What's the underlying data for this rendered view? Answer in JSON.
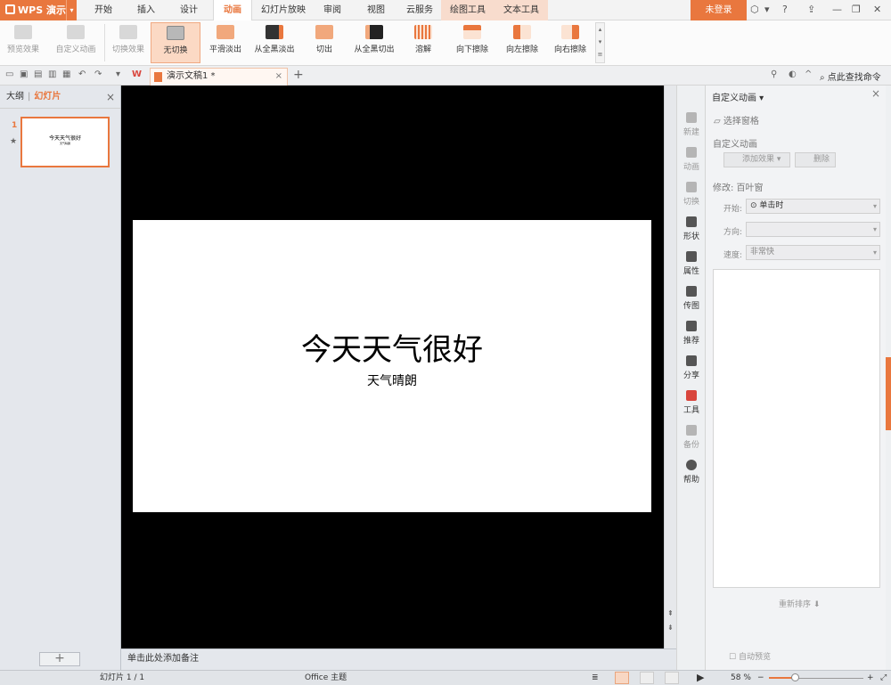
{
  "app": {
    "name": "WPS 演示"
  },
  "menu": {
    "tabs": [
      "开始",
      "插入",
      "设计",
      "动画",
      "幻灯片放映",
      "审阅",
      "视图",
      "云服务",
      "绘图工具",
      "文本工具"
    ],
    "active": "动画",
    "login": "未登录"
  },
  "ribbon": {
    "items": [
      "预览效果",
      "自定义动画",
      "切换效果",
      "无切换",
      "平滑淡出",
      "从全黑淡出",
      "切出",
      "从全黑切出",
      "溶解",
      "向下擦除",
      "向左擦除",
      "向右擦除"
    ]
  },
  "doc": {
    "tab_title": "演示文稿1 *",
    "find_command": "点此查找命令"
  },
  "left_pane": {
    "tab_outline": "大纲",
    "tab_slides": "幻灯片",
    "slide_number": "1"
  },
  "slide": {
    "title": "今天天气很好",
    "subtitle": "天气晴朗"
  },
  "notes": {
    "placeholder": "单击此处添加备注"
  },
  "side_strip": [
    "新建",
    "动画",
    "切换",
    "形状",
    "属性",
    "传图",
    "推荐",
    "分享",
    "工具",
    "备份",
    "帮助"
  ],
  "task_pane": {
    "title": "自定义动画",
    "select_pane": "选择窗格",
    "section": "自定义动画",
    "add_effect": "添加效果",
    "delete": "删除",
    "modify": "修改: 百叶窗",
    "start_label": "开始:",
    "start_value": "单击时",
    "direction_label": "方向:",
    "speed_label": "速度:",
    "speed_value": "非常快",
    "reorder": "重新排序",
    "autopreview": "自动预览"
  },
  "status": {
    "slide_counter": "幻灯片 1 / 1",
    "theme": "Office 主题",
    "zoom": "58 %"
  },
  "colors": {
    "accent": "#e9773e",
    "canvas": "#000000",
    "slide": "#ffffff"
  }
}
